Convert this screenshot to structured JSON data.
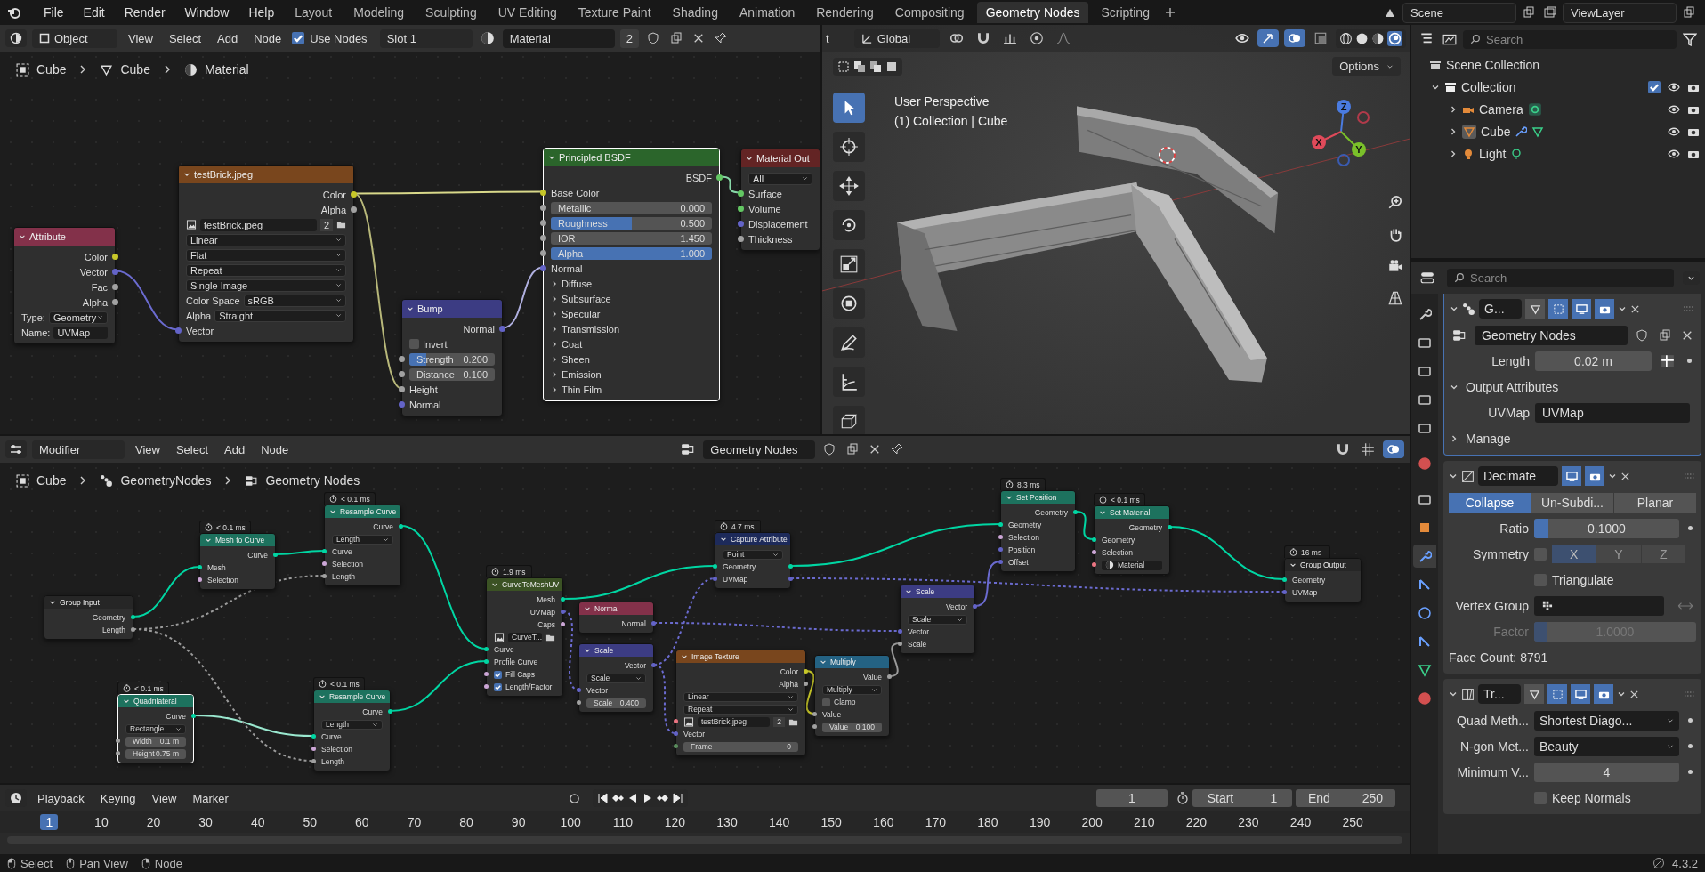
{
  "topbar": {
    "menus": [
      "File",
      "Edit",
      "Render",
      "Window",
      "Help"
    ],
    "workspaces": [
      {
        "label": "Layout",
        "selected": false
      },
      {
        "label": "Modeling",
        "selected": false
      },
      {
        "label": "Sculpting",
        "selected": false
      },
      {
        "label": "UV Editing",
        "selected": false
      },
      {
        "label": "Texture Paint",
        "selected": false
      },
      {
        "label": "Shading",
        "selected": false
      },
      {
        "label": "Animation",
        "selected": false
      },
      {
        "label": "Rendering",
        "selected": false
      },
      {
        "label": "Compositing",
        "selected": false
      },
      {
        "label": "Geometry Nodes",
        "selected": true
      },
      {
        "label": "Scripting",
        "selected": false
      }
    ],
    "scene": "Scene",
    "view_layer": "ViewLayer"
  },
  "shader_editor": {
    "mode": "Object",
    "menus": [
      "View",
      "Select",
      "Add",
      "Node"
    ],
    "use_nodes": {
      "label": "Use Nodes",
      "checked": true
    },
    "slot": "Slot 1",
    "material": "Material",
    "material_users": "2",
    "breadcrumb": [
      "Cube",
      "Cube",
      "Material"
    ],
    "nodes": [
      {
        "title": "Attribute",
        "kind": "input",
        "selected": false,
        "rows": [
          {
            "kind": "out",
            "label": "Color",
            "color": "#c7c729"
          },
          {
            "kind": "out",
            "label": "Vector",
            "color": "#6363c7"
          },
          {
            "kind": "out",
            "label": "Fac",
            "color": "#a1a1a1"
          },
          {
            "kind": "out",
            "label": "Alpha",
            "color": "#a1a1a1"
          },
          {
            "kind": "prop",
            "label": "Type:",
            "value": "Geometry"
          },
          {
            "kind": "text",
            "label": "Name:",
            "value": "UVMap"
          }
        ]
      },
      {
        "title": "testBrick.jpeg",
        "kind": "texture",
        "selected": false,
        "rows": [
          {
            "kind": "out",
            "label": "Color",
            "color": "#c7c729"
          },
          {
            "kind": "out",
            "label": "Alpha",
            "color": "#a1a1a1"
          },
          {
            "kind": "datablock",
            "value": "testBrick.jpeg",
            "users": "2"
          },
          {
            "kind": "select",
            "value": "Linear"
          },
          {
            "kind": "select",
            "value": "Flat"
          },
          {
            "kind": "select",
            "value": "Repeat"
          },
          {
            "kind": "select",
            "value": "Single Image"
          },
          {
            "kind": "prop",
            "label": "Color Space",
            "value": "sRGB"
          },
          {
            "kind": "prop",
            "label": "Alpha",
            "value": "Straight"
          },
          {
            "kind": "in",
            "label": "Vector",
            "color": "#6363c7"
          }
        ]
      },
      {
        "title": "Bump",
        "kind": "vector",
        "selected": false,
        "rows": [
          {
            "kind": "out",
            "label": "Normal",
            "color": "#6363c7"
          },
          {
            "kind": "check",
            "label": "Invert",
            "checked": false
          },
          {
            "kind": "slider",
            "label": "Strength",
            "value": "0.200",
            "level": 0.2,
            "color": "#a1a1a1"
          },
          {
            "kind": "slider",
            "label": "Distance",
            "value": "0.100",
            "level": 0,
            "color": "#a1a1a1"
          },
          {
            "kind": "in",
            "label": "Height",
            "color": "#a1a1a1"
          },
          {
            "kind": "in",
            "label": "Normal",
            "color": "#6363c7"
          }
        ]
      },
      {
        "title": "Principled BSDF",
        "kind": "shader",
        "selected": true,
        "rows": [
          {
            "kind": "out",
            "label": "BSDF",
            "color": "#63c763"
          },
          {
            "kind": "in",
            "label": "Base Color",
            "color": "#c7c729"
          },
          {
            "kind": "slider",
            "label": "Metallic",
            "value": "0.000",
            "level": 0,
            "color": "#a1a1a1"
          },
          {
            "kind": "slider",
            "label": "Roughness",
            "value": "0.500",
            "level": 0.5,
            "color": "#a1a1a1"
          },
          {
            "kind": "slider",
            "label": "IOR",
            "value": "1.450",
            "level": 0,
            "color": "#a1a1a1"
          },
          {
            "kind": "slider",
            "label": "Alpha",
            "value": "1.000",
            "level": 1,
            "color": "#a1a1a1"
          },
          {
            "kind": "in",
            "label": "Normal",
            "color": "#6363c7"
          },
          {
            "kind": "panel",
            "label": "Diffuse"
          },
          {
            "kind": "panel",
            "label": "Subsurface"
          },
          {
            "kind": "panel",
            "label": "Specular"
          },
          {
            "kind": "panel",
            "label": "Transmission"
          },
          {
            "kind": "panel",
            "label": "Coat"
          },
          {
            "kind": "panel",
            "label": "Sheen"
          },
          {
            "kind": "panel",
            "label": "Emission"
          },
          {
            "kind": "panel",
            "label": "Thin Film"
          }
        ]
      },
      {
        "title": "Material Out",
        "kind": "output",
        "selected": false,
        "rows": [
          {
            "kind": "select",
            "value": "All"
          },
          {
            "kind": "in",
            "label": "Surface",
            "color": "#63c763"
          },
          {
            "kind": "in",
            "label": "Volume",
            "color": "#63c763"
          },
          {
            "kind": "in",
            "label": "Displacement",
            "color": "#6363c7"
          },
          {
            "kind": "in",
            "label": "Thickness",
            "color": "#a1a1a1"
          }
        ]
      }
    ]
  },
  "viewport": {
    "cut_label": "t",
    "orientation": "Global",
    "options": "Options",
    "view_name": "User Perspective",
    "view_info": "(1) Collection | Cube",
    "axes": [
      "X",
      "Y",
      "Z"
    ],
    "tools": [
      {
        "kind": "select",
        "selected": true
      },
      {
        "kind": "cursor",
        "selected": false
      },
      {
        "kind": "move",
        "selected": false
      },
      {
        "kind": "rotate",
        "selected": false
      },
      {
        "kind": "scale",
        "selected": false
      },
      {
        "kind": "transform",
        "selected": false
      },
      {
        "kind": "annotate",
        "selected": false
      },
      {
        "kind": "measure",
        "selected": false
      },
      {
        "kind": "add",
        "selected": false
      }
    ]
  },
  "outliner": {
    "search_placeholder": "Search",
    "tree": [
      {
        "label": "Scene Collection",
        "kind": "scene",
        "children": [
          {
            "label": "Collection",
            "kind": "collection",
            "expanded": true,
            "checked": true,
            "children": [
              {
                "label": "Camera",
                "kind": "camera",
                "expanded": false
              },
              {
                "label": "Cube",
                "kind": "mesh",
                "expanded": false
              },
              {
                "label": "Light",
                "kind": "light",
                "expanded": false
              }
            ]
          }
        ]
      }
    ]
  },
  "properties": {
    "search_placeholder": "Search",
    "tabs": [
      {
        "kind": "tool",
        "selected": false
      },
      {
        "kind": "render",
        "selected": false
      },
      {
        "kind": "output",
        "selected": false
      },
      {
        "kind": "view_layer",
        "selected": false
      },
      {
        "kind": "scene",
        "selected": false
      },
      {
        "kind": "world",
        "selected": false
      },
      {
        "kind": "collection",
        "selected": false
      },
      {
        "kind": "object",
        "selected": false
      },
      {
        "kind": "modifier",
        "selected": true
      },
      {
        "kind": "particles",
        "selected": false
      },
      {
        "kind": "physics",
        "selected": false
      },
      {
        "kind": "constraints",
        "selected": false
      },
      {
        "kind": "data",
        "selected": false
      },
      {
        "kind": "material",
        "selected": false
      }
    ],
    "geometry_nodes": {
      "name": "G...",
      "toggles": [
        {
          "kind": "edit_mode",
          "on": false
        },
        {
          "kind": "cage",
          "on": true
        },
        {
          "kind": "viewport",
          "on": true
        },
        {
          "kind": "render",
          "on": true
        }
      ],
      "node_group": "Geometry Nodes",
      "length_label": "Length",
      "length_value": "0.02 m",
      "section": "Output Attributes",
      "uv_label": "UVMap",
      "uv_value": "UVMap",
      "manage": "Manage"
    },
    "decimate": {
      "name": "Decimate",
      "toggles": [
        {
          "kind": "viewport",
          "on": true
        },
        {
          "kind": "render",
          "on": true
        }
      ],
      "modes": [
        {
          "label": "Collapse",
          "selected": true
        },
        {
          "label": "Un-Subdi...",
          "selected": false
        },
        {
          "label": "Planar",
          "selected": false
        }
      ],
      "ratio": {
        "label": "Ratio",
        "value": "0.1000",
        "level": 0.1
      },
      "symmetry": {
        "label": "Symmetry",
        "checked": false
      },
      "axes": [
        {
          "label": "X",
          "selected": true
        },
        {
          "label": "Y",
          "selected": false
        },
        {
          "label": "Z",
          "selected": false
        }
      ],
      "triangulate": {
        "label": "Triangulate",
        "checked": false
      },
      "vertex_group_label": "Vertex Group",
      "factor": {
        "label": "Factor",
        "value": "1.0000",
        "level": 0.08,
        "disabled": true
      },
      "face_count": "Face Count: 8791"
    },
    "triangulate": {
      "name": "Tr...",
      "toggles": [
        {
          "kind": "edit_mode",
          "on": false
        },
        {
          "kind": "cage",
          "on": true
        },
        {
          "kind": "viewport",
          "on": true
        },
        {
          "kind": "render",
          "on": true
        }
      ],
      "quad_label": "Quad Meth...",
      "quad_value": "Shortest Diago...",
      "ngon_label": "N-gon Met...",
      "ngon_value": "Beauty",
      "min_label": "Minimum V...",
      "min_value": "4",
      "keep_normals": {
        "label": "Keep Normals",
        "checked": false
      }
    }
  },
  "geometry_editor": {
    "mode": "Modifier",
    "menus": [
      "View",
      "Select",
      "Add",
      "Node"
    ],
    "node_group": "Geometry Nodes",
    "breadcrumb": [
      "Cube",
      "GeometryNodes",
      "Geometry Nodes"
    ],
    "nodes": [
      {
        "title": "Group Input",
        "kind": "group",
        "selected": false,
        "rows": [
          {
            "kind": "out",
            "label": "Geometry",
            "color": "#00d6a3"
          },
          {
            "kind": "out",
            "label": "Length",
            "color": "#a1a1a1"
          }
        ]
      },
      {
        "title": "Mesh to Curve",
        "kind": "geometry",
        "time": "< 0.1 ms",
        "selected": false,
        "rows": [
          {
            "kind": "out",
            "label": "Curve",
            "color": "#00d6a3"
          },
          {
            "kind": "in",
            "label": "Mesh",
            "color": "#00d6a3"
          },
          {
            "kind": "in",
            "label": "Selection",
            "color": "#cca6d6"
          }
        ]
      },
      {
        "title": "Resample Curve",
        "kind": "geometry",
        "time": "< 0.1 ms",
        "selected": false,
        "rows": [
          {
            "kind": "out",
            "label": "Curve",
            "color": "#00d6a3"
          },
          {
            "kind": "select",
            "value": "Length"
          },
          {
            "kind": "in",
            "label": "Curve",
            "color": "#00d6a3"
          },
          {
            "kind": "in",
            "label": "Selection",
            "color": "#cca6d6"
          },
          {
            "kind": "in",
            "label": "Length",
            "color": "#a1a1a1"
          }
        ]
      },
      {
        "title": "Quadrilateral",
        "kind": "geometry",
        "time": "< 0.1 ms",
        "selected": true,
        "rows": [
          {
            "kind": "out",
            "label": "Curve",
            "color": "#00d6a3"
          },
          {
            "kind": "select",
            "value": "Rectangle"
          },
          {
            "kind": "slider",
            "label": "Width",
            "value": "0.1 m",
            "level": 0,
            "color": "#a1a1a1"
          },
          {
            "kind": "slider",
            "label": "Height",
            "value": "0.75 m",
            "level": 0,
            "color": "#a1a1a1"
          }
        ]
      },
      {
        "title": "Resample Curve",
        "kind": "geometry",
        "time": "< 0.1 ms",
        "selected": false,
        "rows": [
          {
            "kind": "out",
            "label": "Curve",
            "color": "#00d6a3"
          },
          {
            "kind": "select",
            "value": "Length"
          },
          {
            "kind": "in",
            "label": "Curve",
            "color": "#00d6a3"
          },
          {
            "kind": "in",
            "label": "Selection",
            "color": "#cca6d6"
          },
          {
            "kind": "in",
            "label": "Length",
            "color": "#a1a1a1"
          }
        ]
      },
      {
        "title": "CurveToMeshUV",
        "kind": "nodegroup",
        "time": "1.9 ms",
        "selected": false,
        "rows": [
          {
            "kind": "out",
            "label": "Mesh",
            "color": "#00d6a3"
          },
          {
            "kind": "out",
            "label": "UVMap",
            "color": "#6363c7"
          },
          {
            "kind": "out",
            "label": "Caps",
            "color": "#cca6d6"
          },
          {
            "kind": "datablock",
            "value": "CurveT..."
          },
          {
            "kind": "in",
            "label": "Curve",
            "color": "#00d6a3"
          },
          {
            "kind": "in",
            "label": "Profile Curve",
            "color": "#00d6a3"
          },
          {
            "kind": "check",
            "label": "Fill Caps",
            "checked": true,
            "color": "#cca6d6"
          },
          {
            "kind": "check",
            "label": "Length/Factor",
            "checked": true,
            "color": "#cca6d6"
          }
        ]
      },
      {
        "title": "Normal",
        "kind": "input",
        "selected": false,
        "rows": [
          {
            "kind": "out",
            "label": "Normal",
            "color": "#6363c7"
          }
        ]
      },
      {
        "title": "Scale",
        "kind": "vector",
        "selected": false,
        "rows": [
          {
            "kind": "out",
            "label": "Vector",
            "color": "#6363c7"
          },
          {
            "kind": "select",
            "value": "Scale"
          },
          {
            "kind": "in",
            "label": "Vector",
            "color": "#6363c7"
          },
          {
            "kind": "slider",
            "label": "Scale",
            "value": "0.400",
            "level": 0,
            "color": "#a1a1a1"
          }
        ]
      },
      {
        "title": "Capture Attribute",
        "kind": "attribute",
        "time": "4.7 ms",
        "selected": false,
        "rows": [
          {
            "kind": "select",
            "value": "Point"
          },
          {
            "kind": "through",
            "label": "Geometry",
            "color": "#00d6a3"
          },
          {
            "kind": "through",
            "label": "UVMap",
            "color": "#6363c7"
          }
        ]
      },
      {
        "title": "Image Texture",
        "kind": "texture",
        "selected": false,
        "rows": [
          {
            "kind": "out",
            "label": "Color",
            "color": "#c7c729"
          },
          {
            "kind": "out",
            "label": "Alpha",
            "color": "#a1a1a1"
          },
          {
            "kind": "select",
            "value": "Linear"
          },
          {
            "kind": "select",
            "value": "Repeat"
          },
          {
            "kind": "datablock",
            "value": "testBrick.jpeg",
            "users": "2",
            "color": "#eb7582"
          },
          {
            "kind": "in",
            "label": "Vector",
            "color": "#6363c7"
          },
          {
            "kind": "slider",
            "label": "Frame",
            "value": "0",
            "level": 0,
            "color": "#598c5c"
          }
        ]
      },
      {
        "title": "Multiply",
        "kind": "converter",
        "selected": false,
        "rows": [
          {
            "kind": "out",
            "label": "Value",
            "color": "#a1a1a1"
          },
          {
            "kind": "select",
            "value": "Multiply"
          },
          {
            "kind": "check",
            "label": "Clamp",
            "checked": false
          },
          {
            "kind": "in",
            "label": "Value",
            "color": "#a1a1a1"
          },
          {
            "kind": "slider",
            "label": "Value",
            "value": "0.100",
            "level": 0,
            "color": "#a1a1a1"
          }
        ]
      },
      {
        "title": "Scale",
        "kind": "vector",
        "selected": false,
        "rows": [
          {
            "kind": "out",
            "label": "Vector",
            "color": "#6363c7"
          },
          {
            "kind": "select",
            "value": "Scale"
          },
          {
            "kind": "in",
            "label": "Vector",
            "color": "#6363c7"
          },
          {
            "kind": "in",
            "label": "Scale",
            "color": "#a1a1a1"
          }
        ]
      },
      {
        "title": "Set Position",
        "kind": "geometry",
        "time": "8.3 ms",
        "selected": false,
        "rows": [
          {
            "kind": "out",
            "label": "Geometry",
            "color": "#00d6a3"
          },
          {
            "kind": "in",
            "label": "Geometry",
            "color": "#00d6a3"
          },
          {
            "kind": "in",
            "label": "Selection",
            "color": "#cca6d6"
          },
          {
            "kind": "in",
            "label": "Position",
            "color": "#6363c7"
          },
          {
            "kind": "in",
            "label": "Offset",
            "color": "#6363c7"
          }
        ]
      },
      {
        "title": "Set Material",
        "kind": "geometry",
        "time": "< 0.1 ms",
        "selected": false,
        "rows": [
          {
            "kind": "out",
            "label": "Geometry",
            "color": "#00d6a3"
          },
          {
            "kind": "in",
            "label": "Geometry",
            "color": "#00d6a3"
          },
          {
            "kind": "in",
            "label": "Selection",
            "color": "#cca6d6"
          },
          {
            "kind": "material",
            "value": "Material",
            "color": "#eb7582"
          }
        ]
      },
      {
        "title": "Group Output",
        "kind": "group",
        "time": "16 ms",
        "selected": false,
        "rows": [
          {
            "kind": "in",
            "label": "Geometry",
            "color": "#00d6a3"
          },
          {
            "kind": "in",
            "label": "UVMap",
            "color": "#6363c7"
          }
        ]
      }
    ]
  },
  "timeline": {
    "menus": [
      "Playback",
      "Keying",
      "View",
      "Marker"
    ],
    "current_frame": "1",
    "start_label": "Start",
    "start": "1",
    "end_label": "End",
    "end": "250",
    "ticks": [
      {
        "label": "1",
        "selected": true
      },
      {
        "label": "10",
        "selected": false
      },
      {
        "label": "20",
        "selected": false
      },
      {
        "label": "30",
        "selected": false
      },
      {
        "label": "40",
        "selected": false
      },
      {
        "label": "50",
        "selected": false
      },
      {
        "label": "60",
        "selected": false
      },
      {
        "label": "70",
        "selected": false
      },
      {
        "label": "80",
        "selected": false
      },
      {
        "label": "90",
        "selected": false
      },
      {
        "label": "100",
        "selected": false
      },
      {
        "label": "110",
        "selected": false
      },
      {
        "label": "120",
        "selected": false
      },
      {
        "label": "130",
        "selected": false
      },
      {
        "label": "140",
        "selected": false
      },
      {
        "label": "150",
        "selected": false
      },
      {
        "label": "160",
        "selected": false
      },
      {
        "label": "170",
        "selected": false
      },
      {
        "label": "180",
        "selected": false
      },
      {
        "label": "190",
        "selected": false
      },
      {
        "label": "200",
        "selected": false
      },
      {
        "label": "210",
        "selected": false
      },
      {
        "label": "220",
        "selected": false
      },
      {
        "label": "230",
        "selected": false
      },
      {
        "label": "240",
        "selected": false
      },
      {
        "label": "250",
        "selected": false
      }
    ]
  },
  "status_bar": {
    "hints": [
      "Select",
      "Pan View",
      "Node"
    ],
    "version": "4.3.2"
  }
}
